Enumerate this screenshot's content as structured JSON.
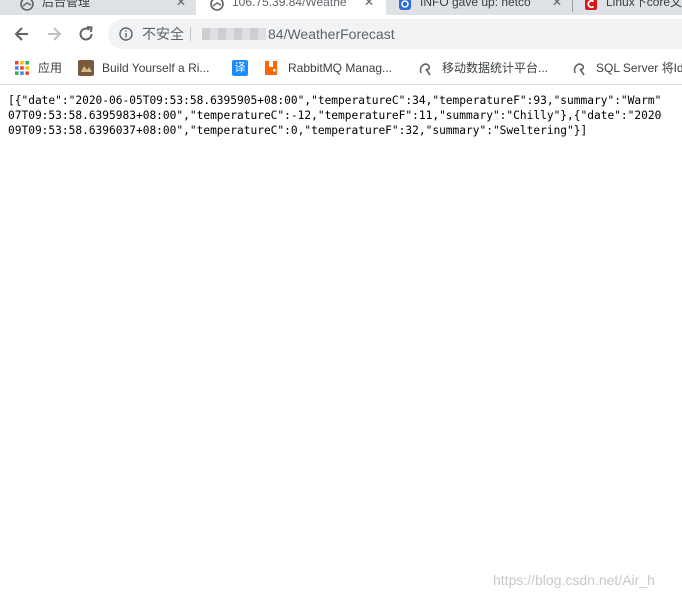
{
  "tabs": [
    {
      "title": "后台管理",
      "icon": "globe-icon",
      "close": "✕"
    },
    {
      "title": "106.75.39.84/Weathe",
      "icon": "globe-icon",
      "close": "✕",
      "active": true
    },
    {
      "title": "INFO gave up: netco",
      "icon": "csdn-icon",
      "close": "✕"
    },
    {
      "title": "Linux下core文",
      "icon": "csdn-red-icon",
      "close": ""
    }
  ],
  "address_bar": {
    "security_label": "不安全",
    "url_suffix": "84/WeatherForecast"
  },
  "bookmarks": [
    {
      "label": "应用",
      "icon": "apps-grid-icon"
    },
    {
      "label": "Build Yourself a Ri...",
      "icon": "bookmark-image-icon"
    },
    {
      "label": "",
      "icon": "translate-icon",
      "glyph": "译"
    },
    {
      "label": "RabbitMQ Manag...",
      "icon": "rabbitmq-icon"
    },
    {
      "label": "移动数据统计平台...",
      "icon": "swirl-icon"
    },
    {
      "label": "SQL Server 将Id",
      "icon": "swirl-icon"
    }
  ],
  "page": {
    "json_lines": [
      "[{\"date\":\"2020-06-05T09:53:58.6395905+08:00\",\"temperatureC\":34,\"temperatureF\":93,\"summary\":\"Warm\"",
      "07T09:53:58.6395983+08:00\",\"temperatureC\":-12,\"temperatureF\":11,\"summary\":\"Chilly\"},{\"date\":\"2020",
      "09T09:53:58.6396037+08:00\",\"temperatureC\":0,\"temperatureF\":32,\"summary\":\"Sweltering\"}]"
    ]
  },
  "watermark": "https://blog.csdn.net/Air_h"
}
